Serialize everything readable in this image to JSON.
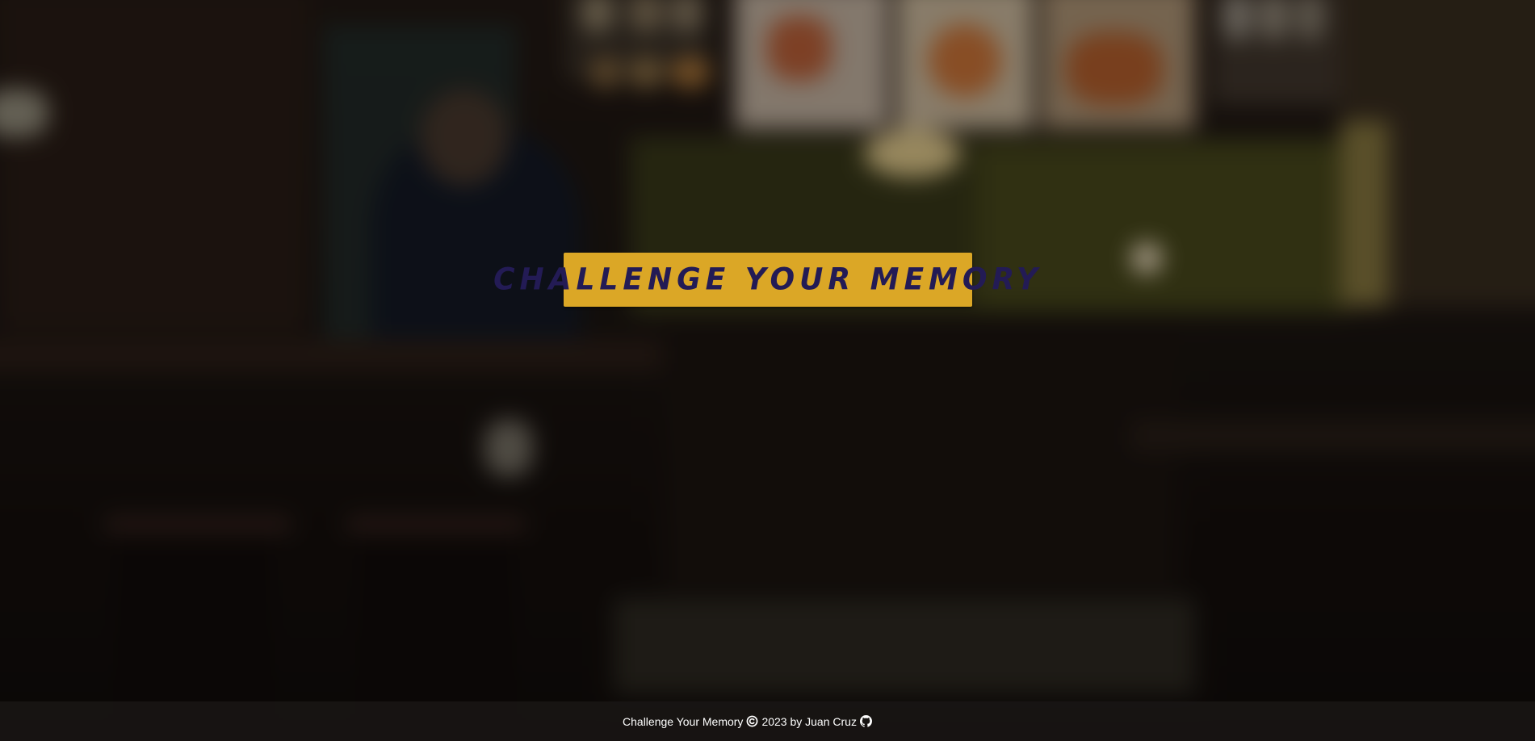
{
  "title": {
    "text": "Challenge Your Memory"
  },
  "footer": {
    "app_name": "Challenge Your Memory",
    "copyright_icon": "copyright-icon",
    "year_by": "2023 by Juan Cruz",
    "github_icon": "github-icon"
  },
  "colors": {
    "banner_background": "#dba726",
    "banner_text": "#231b55",
    "footer_background": "#191614",
    "footer_text": "#ffffff"
  }
}
